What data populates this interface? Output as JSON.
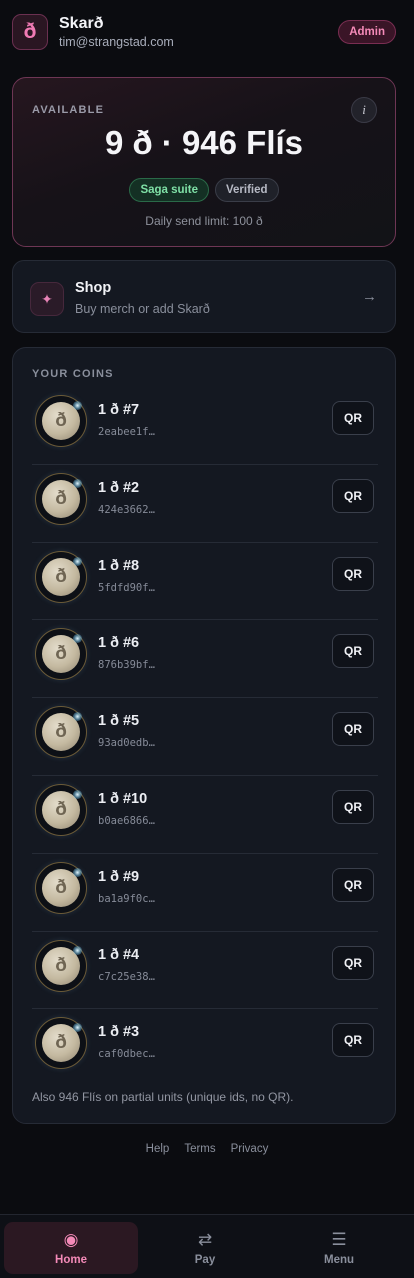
{
  "header": {
    "logo_glyph": "ð",
    "brand_name": "Skarð",
    "email": "tim@strangstad.com",
    "role_badge": "Admin"
  },
  "balance": {
    "label": "AVAILABLE",
    "info_glyph": "i",
    "amount": "9 ð · 946 Flís",
    "badges": [
      "Saga suite",
      "Verified"
    ],
    "send_limit": "Daily send limit: 100 ð"
  },
  "shop": {
    "icon": "sparkle-icon",
    "icon_glyph": "✦",
    "title": "Shop",
    "subtitle": "Buy merch or add Skarð",
    "arrow_glyph": "→"
  },
  "coins": {
    "label": "YOUR COINS",
    "coin_glyph": "ð",
    "qr_label": "QR",
    "items": [
      {
        "name": "1 ð #7",
        "hash": "2eabee1f…"
      },
      {
        "name": "1 ð #2",
        "hash": "424e3662…"
      },
      {
        "name": "1 ð #8",
        "hash": "5fdfd90f…"
      },
      {
        "name": "1 ð #6",
        "hash": "876b39bf…"
      },
      {
        "name": "1 ð #5",
        "hash": "93ad0edb…"
      },
      {
        "name": "1 ð #10",
        "hash": "b0ae6866…"
      },
      {
        "name": "1 ð #9",
        "hash": "ba1a9f0c…"
      },
      {
        "name": "1 ð #4",
        "hash": "c7c25e38…"
      },
      {
        "name": "1 ð #3",
        "hash": "caf0dbec…"
      }
    ],
    "partial_note": "Also 946 Flís on partial units (unique ids, no QR)."
  },
  "footer": {
    "links": [
      "Help",
      "Terms",
      "Privacy"
    ]
  },
  "nav": {
    "items": [
      {
        "label": "Home",
        "icon": "target-icon",
        "glyph": "◉",
        "active": true
      },
      {
        "label": "Pay",
        "icon": "swap-icon",
        "glyph": "⇄",
        "active": false
      },
      {
        "label": "Menu",
        "icon": "hamburger-icon",
        "glyph": "☰",
        "active": false
      }
    ]
  },
  "colors": {
    "accent_pink": "#f48ab8",
    "verified_green": "#7fe0a6",
    "background": "#0b0c10",
    "card": "#141821"
  }
}
